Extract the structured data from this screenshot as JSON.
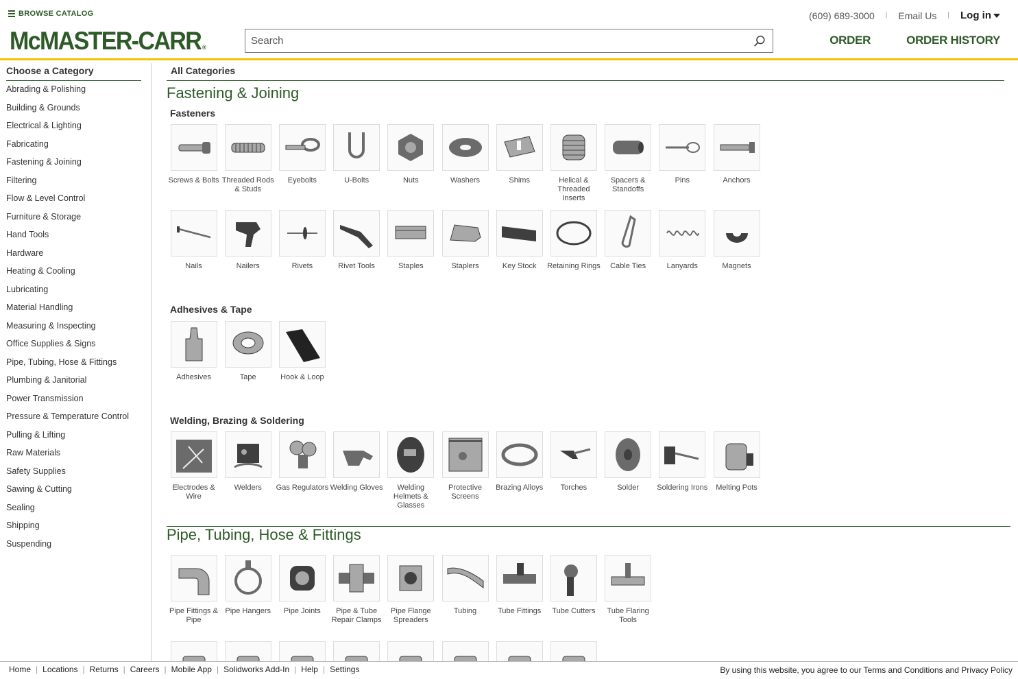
{
  "header": {
    "browse_label": "BROWSE CATALOG",
    "logo": "McMASTER-CARR",
    "logo_mark": "®",
    "search_placeholder": "Search",
    "phone": "(609) 689-3000",
    "email": "Email Us",
    "login": "Log in",
    "order": "ORDER",
    "order_history": "ORDER HISTORY",
    "accent_color": "#f4c200",
    "brand_color": "#2d5a27"
  },
  "sidebar": {
    "heading": "Choose a Category",
    "items": [
      "Abrading & Polishing",
      "Building & Grounds",
      "Electrical & Lighting",
      "Fabricating",
      "Fastening & Joining",
      "Filtering",
      "Flow & Level Control",
      "Furniture & Storage",
      "Hand Tools",
      "Hardware",
      "Heating & Cooling",
      "Lubricating",
      "Material Handling",
      "Measuring & Inspecting",
      "Office Supplies & Signs",
      "Pipe, Tubing, Hose & Fittings",
      "Plumbing & Janitorial",
      "Power Transmission",
      "Pressure & Temperature Control",
      "Pulling & Lifting",
      "Raw Materials",
      "Safety Supplies",
      "Sawing & Cutting",
      "Sealing",
      "Shipping",
      "Suspending"
    ]
  },
  "main": {
    "all_categories": "All Categories",
    "fastening": {
      "title": "Fastening & Joining",
      "fasteners": {
        "title": "Fasteners",
        "row1": [
          {
            "label": "Screws & Bolts",
            "icon": "screw-icon"
          },
          {
            "label": "Threaded Rods & Studs",
            "icon": "threaded-rod-icon"
          },
          {
            "label": "Eyebolts",
            "icon": "eyebolt-icon"
          },
          {
            "label": "U-Bolts",
            "icon": "u-bolt-icon"
          },
          {
            "label": "Nuts",
            "icon": "nut-icon"
          },
          {
            "label": "Washers",
            "icon": "washer-icon"
          },
          {
            "label": "Shims",
            "icon": "shim-icon"
          },
          {
            "label": "Helical & Threaded Inserts",
            "icon": "helical-insert-icon"
          },
          {
            "label": "Spacers & Standoffs",
            "icon": "spacer-icon"
          },
          {
            "label": "Pins",
            "icon": "pin-icon"
          },
          {
            "label": "Anchors",
            "icon": "anchor-icon"
          }
        ],
        "row2": [
          {
            "label": "Nails",
            "icon": "nail-icon"
          },
          {
            "label": "Nailers",
            "icon": "nailer-icon"
          },
          {
            "label": "Rivets",
            "icon": "rivet-icon"
          },
          {
            "label": "Rivet Tools",
            "icon": "rivet-tool-icon"
          },
          {
            "label": "Staples",
            "icon": "staples-icon"
          },
          {
            "label": "Staplers",
            "icon": "stapler-icon"
          },
          {
            "label": "Key Stock",
            "icon": "key-stock-icon"
          },
          {
            "label": "Retaining Rings",
            "icon": "retaining-ring-icon"
          },
          {
            "label": "Cable Ties",
            "icon": "cable-tie-icon"
          },
          {
            "label": "Lanyards",
            "icon": "lanyard-icon"
          },
          {
            "label": "Magnets",
            "icon": "magnet-icon"
          }
        ]
      },
      "adhesives": {
        "title": "Adhesives & Tape",
        "row1": [
          {
            "label": "Adhesives",
            "icon": "adhesive-icon"
          },
          {
            "label": "Tape",
            "icon": "tape-icon"
          },
          {
            "label": "Hook & Loop",
            "icon": "hook-loop-icon"
          }
        ]
      },
      "welding": {
        "title": "Welding, Brazing & Soldering",
        "row1": [
          {
            "label": "Electrodes & Wire",
            "icon": "electrode-icon"
          },
          {
            "label": "Welders",
            "icon": "welder-icon"
          },
          {
            "label": "Gas Regulators",
            "icon": "gas-regulator-icon"
          },
          {
            "label": "Welding Gloves",
            "icon": "glove-icon"
          },
          {
            "label": "Welding Helmets & Glasses",
            "icon": "helmet-icon"
          },
          {
            "label": "Protective Screens",
            "icon": "screen-icon"
          },
          {
            "label": "Brazing Alloys",
            "icon": "brazing-alloy-icon"
          },
          {
            "label": "Torches",
            "icon": "torch-icon"
          },
          {
            "label": "Solder",
            "icon": "solder-icon"
          },
          {
            "label": "Soldering Irons",
            "icon": "soldering-iron-icon"
          },
          {
            "label": "Melting Pots",
            "icon": "melting-pot-icon"
          }
        ]
      }
    },
    "pipe": {
      "title": "Pipe, Tubing, Hose & Fittings",
      "row1": [
        {
          "label": "Pipe Fittings & Pipe",
          "icon": "pipe-fitting-icon"
        },
        {
          "label": "Pipe Hangers",
          "icon": "pipe-hanger-icon"
        },
        {
          "label": "Pipe Joints",
          "icon": "pipe-joint-icon"
        },
        {
          "label": "Pipe & Tube Repair Clamps",
          "icon": "repair-clamp-icon"
        },
        {
          "label": "Pipe Flange Spreaders",
          "icon": "flange-spreader-icon"
        },
        {
          "label": "Tubing",
          "icon": "tubing-icon"
        },
        {
          "label": "Tube Fittings",
          "icon": "tube-fitting-icon"
        },
        {
          "label": "Tube Cutters",
          "icon": "tube-cutter-icon"
        },
        {
          "label": "Tube Flaring Tools",
          "icon": "flaring-tool-icon"
        }
      ]
    }
  },
  "footer": {
    "links": [
      "Home",
      "Locations",
      "Returns",
      "Careers",
      "Mobile App",
      "Solidworks Add-In",
      "Help",
      "Settings"
    ],
    "terms": "By using this website, you agree to our Terms and Conditions and Privacy Policy"
  }
}
